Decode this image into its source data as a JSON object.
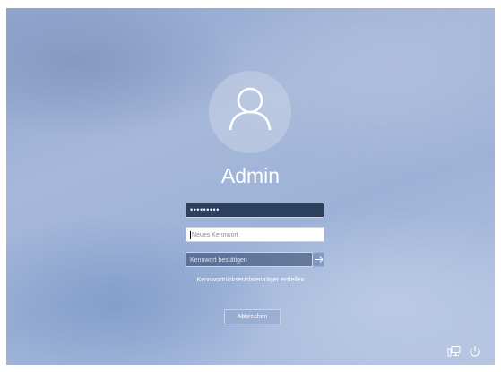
{
  "user": {
    "name": "Admin"
  },
  "password_form": {
    "current_password_mask": "•••••••••",
    "new_password_placeholder": "Neues Kennwort",
    "confirm_password_placeholder": "Kennwort bestätigen",
    "submit_icon": "arrow-right-icon"
  },
  "links": {
    "create_reset_disk": "Kennwortrücksetzdatenträger erstellen"
  },
  "buttons": {
    "cancel": "Abbrechen"
  },
  "system_tray": {
    "icons": [
      "network-icon",
      "power-icon"
    ]
  },
  "colors": {
    "field_dark": "#2b3f5e",
    "field_border": "#c9d4e6",
    "text": "#ffffff"
  }
}
